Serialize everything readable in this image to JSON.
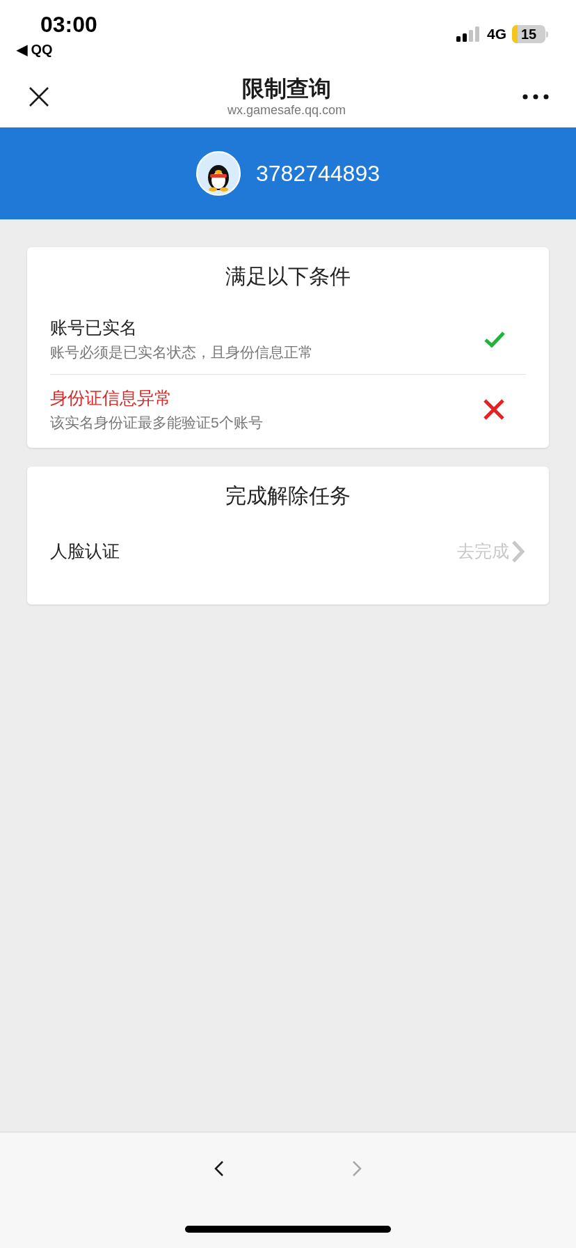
{
  "status_bar": {
    "time": "03:00",
    "back_app": "◀ QQ",
    "network": "4G",
    "battery": "15"
  },
  "nav": {
    "title": "限制查询",
    "url": "wx.gamesafe.qq.com"
  },
  "account": {
    "number": "3782744893"
  },
  "conditions": {
    "title": "满足以下条件",
    "items": [
      {
        "label": "账号已实名",
        "description": "账号必须是已实名状态，且身份信息正常",
        "met": true
      },
      {
        "label": "身份证信息异常",
        "description": "该实名身份证最多能验证5个账号",
        "met": false
      }
    ]
  },
  "tasks": {
    "title": "完成解除任务",
    "items": [
      {
        "label": "人脸认证",
        "action": "去完成"
      }
    ]
  },
  "toolbar": {
    "back_disabled": false,
    "forward_disabled": true
  }
}
